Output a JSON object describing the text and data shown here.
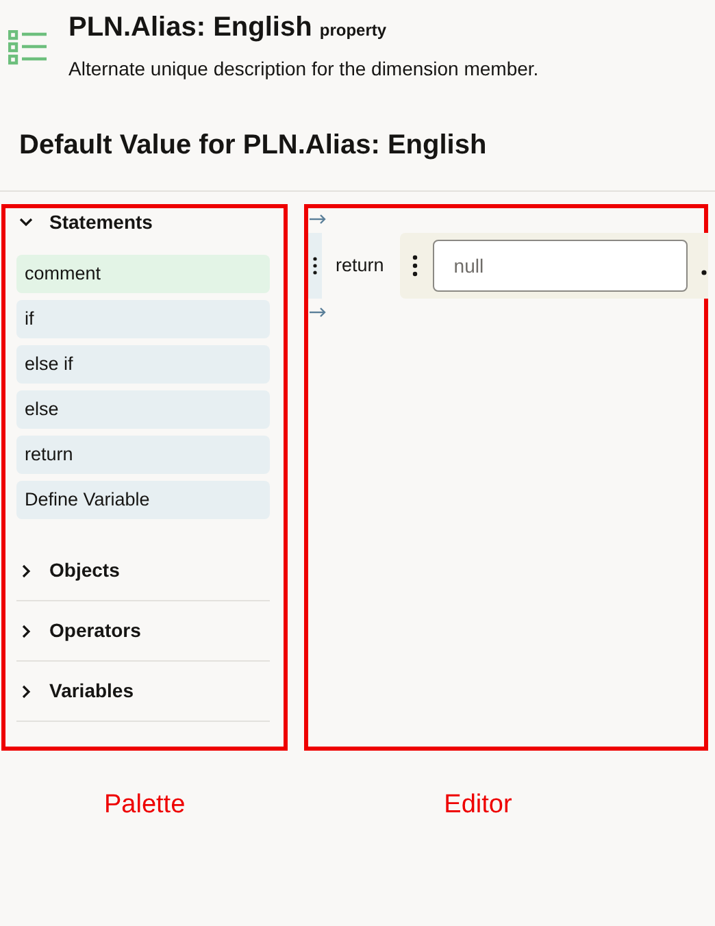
{
  "header": {
    "title": "PLN.Alias: English",
    "title_suffix": "property",
    "description": "Alternate unique description for the dimension member."
  },
  "heading": "Default Value for PLN.Alias: English",
  "palette": {
    "sections": [
      {
        "label": "Statements",
        "expanded": true,
        "items": [
          {
            "label": "comment",
            "kind": "comment"
          },
          {
            "label": "if",
            "kind": "statement"
          },
          {
            "label": "else if",
            "kind": "statement"
          },
          {
            "label": "else",
            "kind": "statement"
          },
          {
            "label": "return",
            "kind": "statement"
          },
          {
            "label": "Define Variable",
            "kind": "statement"
          }
        ]
      },
      {
        "label": "Objects",
        "expanded": false
      },
      {
        "label": "Operators",
        "expanded": false
      },
      {
        "label": "Variables",
        "expanded": false
      }
    ]
  },
  "editor": {
    "statements": [
      {
        "keyword": "return",
        "value_placeholder": "null"
      }
    ]
  },
  "annotations": [
    {
      "label": "Palette"
    },
    {
      "label": "Editor"
    }
  ]
}
